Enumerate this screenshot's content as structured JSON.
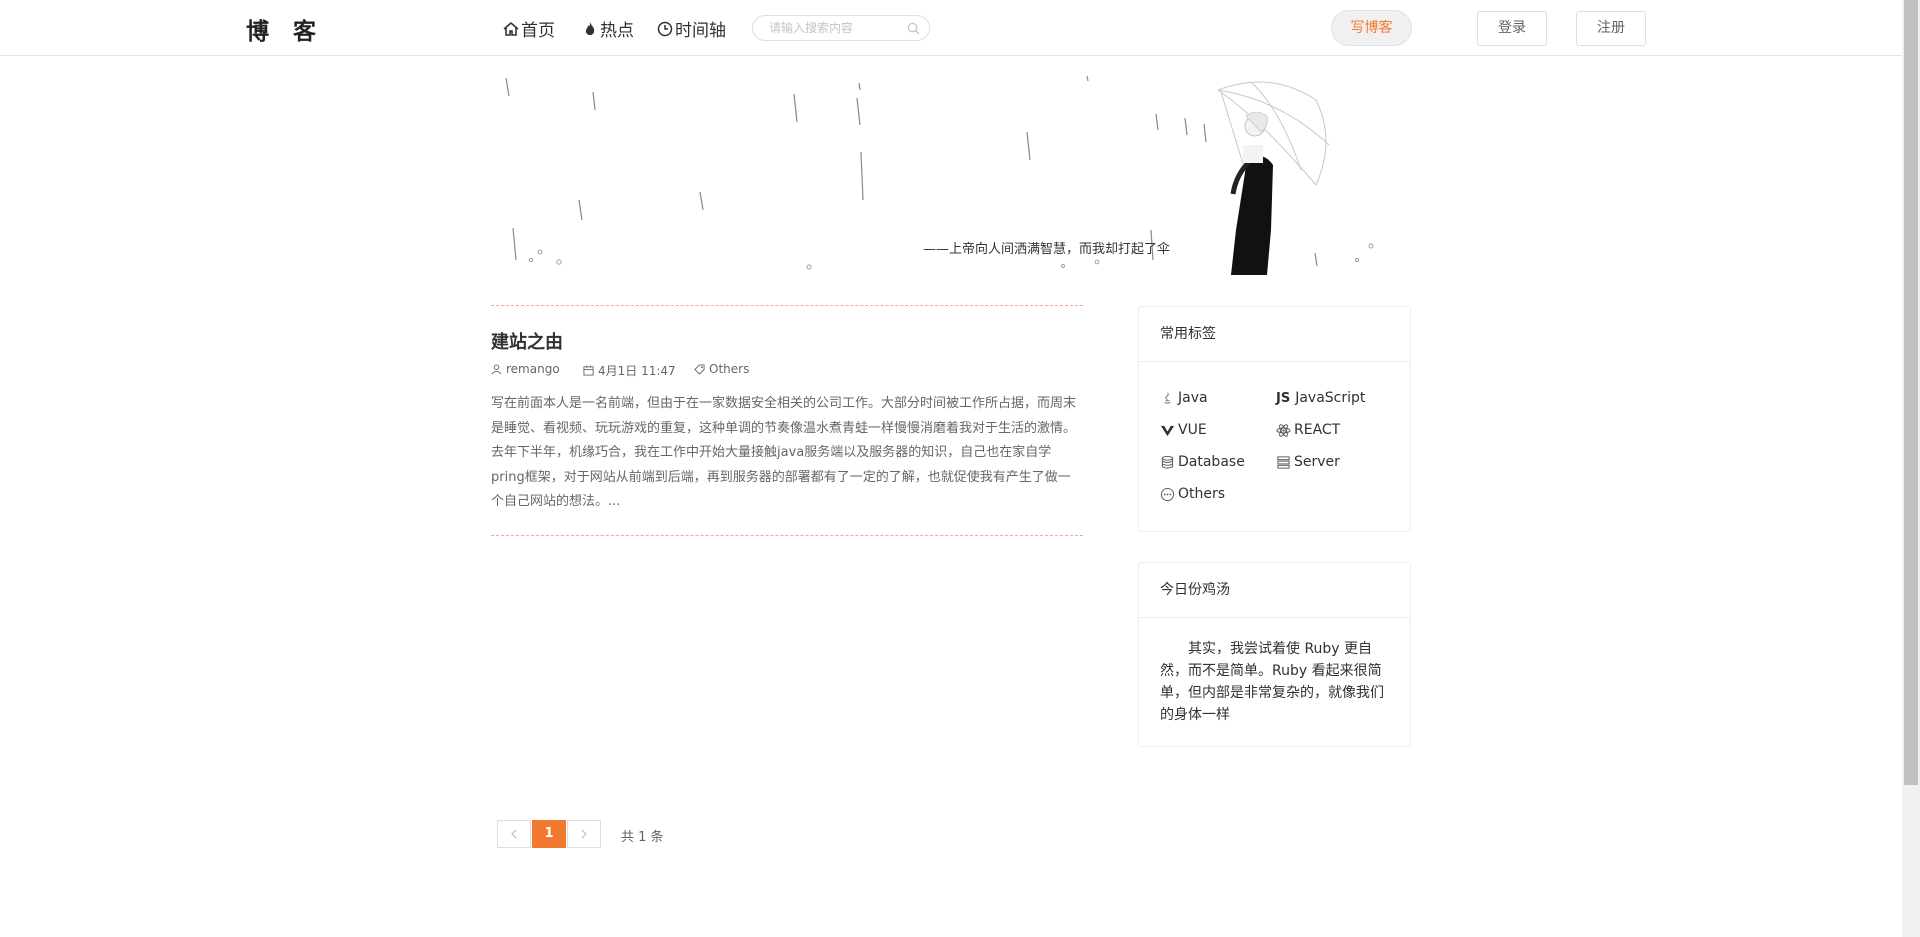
{
  "header": {
    "logo": "博 客",
    "nav": [
      {
        "label": "首页",
        "icon": "home-icon"
      },
      {
        "label": "热点",
        "icon": "fire-icon"
      },
      {
        "label": "时间轴",
        "icon": "clock-icon"
      }
    ],
    "search_placeholder": "请输入搜索内容",
    "write_label": "写博客",
    "login_label": "登录",
    "register_label": "注册"
  },
  "banner": {
    "quote": "——上帝向人间洒满智慧，而我却打起了伞"
  },
  "post": {
    "title": "建站之由",
    "author": "remango",
    "date": "4月1日 11:47",
    "tag": "Others",
    "excerpt": "写在前面本人是一名前端，但由于在一家数据安全相关的公司工作。大部分时间被工作所占据，而周末是睡觉、看视频、玩玩游戏的重复，这种单调的节奏像温水煮青蛙一样慢慢消磨着我对于生活的激情。去年下半年，机缘巧合，我在工作中开始大量接触java服务端以及服务器的知识，自己也在家自学pring框架，对于网站从前端到后端，再到服务器的部署都有了一定的了解，也就促使我有产生了做一个自己网站的想法。..."
  },
  "tags_card": {
    "title": "常用标签",
    "tags": [
      {
        "label": "Java",
        "icon": "java-icon"
      },
      {
        "label": "JavaScript",
        "icon": "js-icon",
        "prefix": "JS"
      },
      {
        "label": "VUE",
        "icon": "vue-icon"
      },
      {
        "label": "REACT",
        "icon": "react-icon"
      },
      {
        "label": "Database",
        "icon": "database-icon"
      },
      {
        "label": "Server",
        "icon": "server-icon"
      },
      {
        "label": "Others",
        "icon": "more-icon"
      }
    ]
  },
  "soup_card": {
    "title": "今日份鸡汤",
    "text": "其实，我尝试着使 Ruby 更自然，而不是简单。Ruby 看起来很简单，但内部是非常复杂的，就像我们的身体一样"
  },
  "pagination": {
    "current": "1",
    "total": "共 1 条"
  },
  "colors": {
    "accent": "#f27a30",
    "divider": "#f7a98a"
  }
}
